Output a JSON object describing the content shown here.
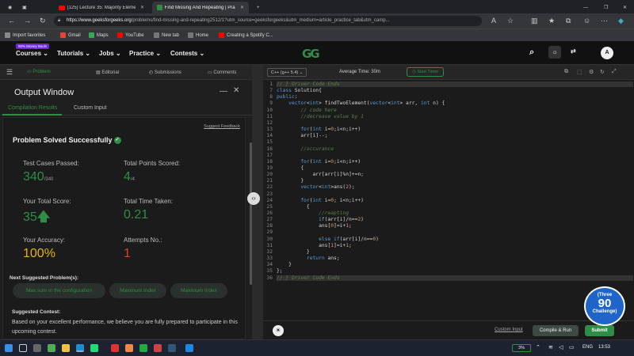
{
  "browser": {
    "tabs": [
      {
        "label": "(125) Lecture 35: Majority Eleme...",
        "icon_color": "#ff0000"
      },
      {
        "label": "Find Missing And Repeating | Pra...",
        "icon_color": "#2f8d46"
      }
    ],
    "url_host": "https://www.geeksforgeeks.org",
    "url_path": "/problems/find-missing-and-repeating2512/1?utm_source=geeksforgeeks&utm_medium=article_practice_tab&utm_camp...",
    "bookmarks": [
      "Import favorites",
      "Gmail",
      "Maps",
      "YouTube",
      "New tab",
      "Home",
      "Creating a Spotify C..."
    ]
  },
  "site": {
    "badge": "90% Money Back!",
    "menu": [
      "Courses",
      "Tutorials",
      "Jobs",
      "Practice",
      "Contests"
    ],
    "logo": "GG",
    "avatar": "A"
  },
  "left_tabs": [
    "Problem",
    "Editorial",
    "Submissions",
    "Comments"
  ],
  "output": {
    "title": "Output Window",
    "tabs": [
      "Compilation Results",
      "Custom Input"
    ],
    "feedback": "Suggest Feedback",
    "status": "Problem Solved Successfully",
    "stats": {
      "test_cases_label": "Test Cases Passed:",
      "test_cases": "340",
      "test_cases_total": "/340",
      "points_label": "Total Points Scored:",
      "points": "4",
      "points_total": "/4",
      "score_label": "Your Total Score:",
      "score": "35",
      "time_label": "Total Time Taken:",
      "time": "0.21",
      "accuracy_label": "Your Accuracy:",
      "accuracy": "100%",
      "attempts_label": "Attempts No.:",
      "attempts": "1"
    },
    "next_title": "Next Suggested Problem(s):",
    "suggestions": [
      "Max sum in the configuration",
      "Maximum Index",
      "Maximum Index"
    ],
    "contest_title": "Suggested Contest:",
    "contest_body": "Based on your excellent performance, we believe you are fully prepared to participate in this upcoming contest."
  },
  "editor": {
    "language": "C++ (g++ 5.4)",
    "avg_time": "Average Time: 30m",
    "timer": "Start Timer",
    "line_numbers": [
      "1",
      "7",
      "8",
      "9",
      "10",
      "11",
      "12",
      "13",
      "14",
      "15",
      "16",
      "17",
      "18",
      "19",
      "20",
      "21",
      "22",
      "23",
      "24",
      "25",
      "26",
      "27",
      "28",
      "29",
      "30",
      "31",
      "32",
      "33",
      "34",
      "35",
      "36"
    ],
    "lines": [
      "// } Driver Code Ends",
      "class Solution{",
      "public:",
      "    vector<int> findTwoElement(vector<int> arr, int n) {",
      "        // code here",
      "        //decrease value by 1",
      "",
      "        for(int i=0;i<n;i++)",
      "        arr[i]--;",
      "",
      "        //occurance",
      "",
      "        for(int i=0;i<n;i++)",
      "        {",
      "            arr[arr[i]%n]+=n;",
      "        }",
      "        vector<int>ans(2);",
      "",
      "        for(int i=0; i<n;i++)",
      "          {",
      "              //reapting",
      "              if(arr[i]/n==2)",
      "              ans[0]=i+1;",
      "",
      "              else if(arr[i]/n==0)",
      "              ans[1]=i+1;",
      "          }",
      "          return ans;",
      "    }",
      "};",
      "// } Driver Code Ends"
    ],
    "custom_input": "Custom Input",
    "compile": "Compile & Run",
    "submit": "Submit",
    "challenge_line1": "Three",
    "challenge_num": "90",
    "challenge_line2": "Challenge"
  },
  "taskbar": {
    "battery": "3%",
    "lang": "ENG",
    "clock": "13:53"
  }
}
